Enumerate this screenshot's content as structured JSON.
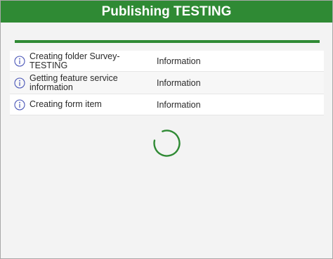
{
  "dialog": {
    "title": "Publishing TESTING"
  },
  "progress": {
    "fraction": 1.0,
    "color": "#2f8a34"
  },
  "log": [
    {
      "icon": "info-icon",
      "message": "Creating folder Survey-TESTING",
      "level": "Information"
    },
    {
      "icon": "info-icon",
      "message": "Getting feature service information",
      "level": "Information"
    },
    {
      "icon": "info-icon",
      "message": "Creating form item",
      "level": "Information"
    }
  ],
  "colors": {
    "accent": "#2f8a34",
    "info_icon": "#4a56b8",
    "background": "#f3f3f3"
  },
  "spinner": {
    "icon": "loading-spinner-icon"
  }
}
